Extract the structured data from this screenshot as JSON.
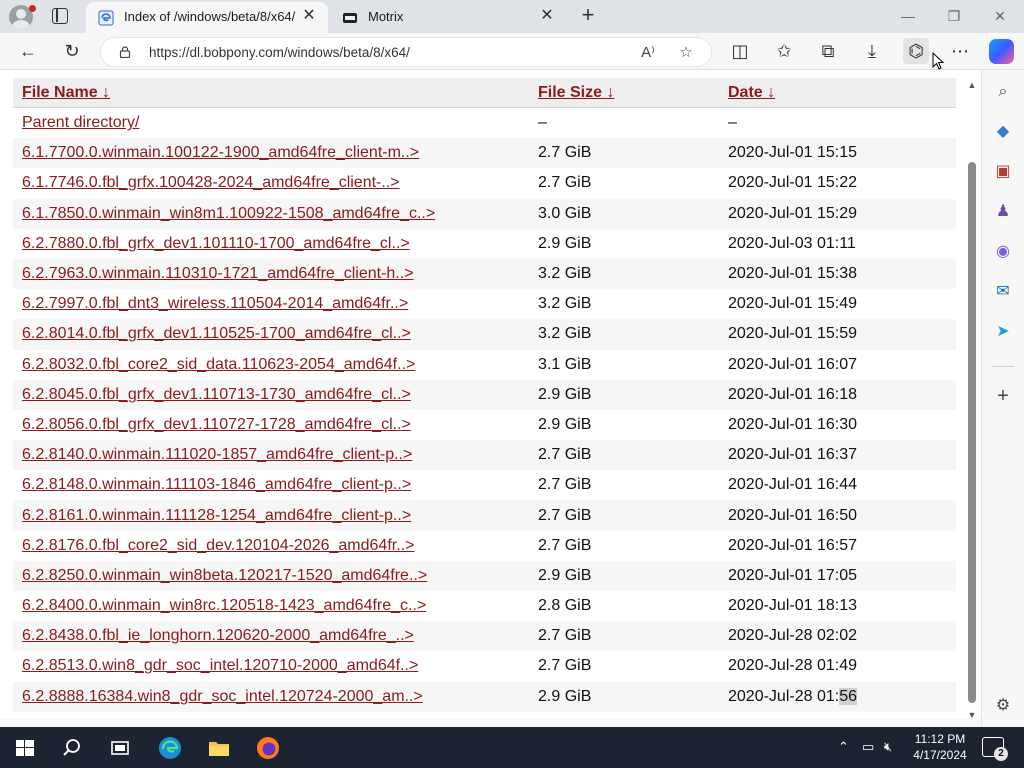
{
  "browser": {
    "tabs": [
      {
        "title": "Index of /windows/beta/8/x64/",
        "active": true
      },
      {
        "title": "Motrix",
        "active": false
      }
    ],
    "url": "https://dl.bobpony.com/windows/beta/8/x64/"
  },
  "listing": {
    "headers": {
      "name": "File Name  ↓",
      "size": "File Size  ↓",
      "date": "Date  ↓"
    },
    "rows": [
      {
        "name": "Parent directory/",
        "size": "–",
        "date": "–"
      },
      {
        "name": "6.1.7700.0.winmain.100122-1900_amd64fre_client-m..>",
        "size": "2.7 GiB",
        "date": "2020-Jul-01 15:15"
      },
      {
        "name": "6.1.7746.0.fbl_grfx.100428-2024_amd64fre_client-..>",
        "size": "2.7 GiB",
        "date": "2020-Jul-01 15:22"
      },
      {
        "name": "6.1.7850.0.winmain_win8m1.100922-1508_amd64fre_c..>",
        "size": "3.0 GiB",
        "date": "2020-Jul-01 15:29"
      },
      {
        "name": "6.2.7880.0.fbl_grfx_dev1.101110-1700_amd64fre_cl..>",
        "size": "2.9 GiB",
        "date": "2020-Jul-03 01:11"
      },
      {
        "name": "6.2.7963.0.winmain.110310-1721_amd64fre_client-h..>",
        "size": "3.2 GiB",
        "date": "2020-Jul-01 15:38"
      },
      {
        "name": "6.2.7997.0.fbl_dnt3_wireless.110504-2014_amd64fr..>",
        "size": "3.2 GiB",
        "date": "2020-Jul-01 15:49"
      },
      {
        "name": "6.2.8014.0.fbl_grfx_dev1.110525-1700_amd64fre_cl..>",
        "size": "3.2 GiB",
        "date": "2020-Jul-01 15:59"
      },
      {
        "name": "6.2.8032.0.fbl_core2_sid_data.110623-2054_amd64f..>",
        "size": "3.1 GiB",
        "date": "2020-Jul-01 16:07"
      },
      {
        "name": "6.2.8045.0.fbl_grfx_dev1.110713-1730_amd64fre_cl..>",
        "size": "2.9 GiB",
        "date": "2020-Jul-01 16:18"
      },
      {
        "name": "6.2.8056.0.fbl_grfx_dev1.110727-1728_amd64fre_cl..>",
        "size": "2.9 GiB",
        "date": "2020-Jul-01 16:30"
      },
      {
        "name": "6.2.8140.0.winmain.111020-1857_amd64fre_client-p..>",
        "size": "2.7 GiB",
        "date": "2020-Jul-01 16:37"
      },
      {
        "name": "6.2.8148.0.winmain.111103-1846_amd64fre_client-p..>",
        "size": "2.7 GiB",
        "date": "2020-Jul-01 16:44"
      },
      {
        "name": "6.2.8161.0.winmain.111128-1254_amd64fre_client-p..>",
        "size": "2.7 GiB",
        "date": "2020-Jul-01 16:50"
      },
      {
        "name": "6.2.8176.0.fbl_core2_sid_dev.120104-2026_amd64fr..>",
        "size": "2.7 GiB",
        "date": "2020-Jul-01 16:57"
      },
      {
        "name": "6.2.8250.0.winmain_win8beta.120217-1520_amd64fre..>",
        "size": "2.9 GiB",
        "date": "2020-Jul-01 17:05"
      },
      {
        "name": "6.2.8400.0.winmain_win8rc.120518-1423_amd64fre_c..>",
        "size": "2.8 GiB",
        "date": "2020-Jul-01 18:13"
      },
      {
        "name": "6.2.8438.0.fbl_ie_longhorn.120620-2000_amd64fre_..>",
        "size": "2.7 GiB",
        "date": "2020-Jul-28 02:02"
      },
      {
        "name": "6.2.8513.0.win8_gdr_soc_intel.120710-2000_amd64f..>",
        "size": "2.7 GiB",
        "date": "2020-Jul-28 01:49"
      },
      {
        "name": "6.2.8888.16384.win8_gdr_soc_intel.120724-2000_am..>",
        "size": "2.9 GiB",
        "date_prefix": "2020-Jul-28 01:",
        "date_selected": "56"
      }
    ]
  },
  "taskbar": {
    "time": "11:12 PM",
    "date": "4/17/2024",
    "notification_count": "2"
  },
  "colors": {
    "link": "#8b1a1a",
    "taskbar_bg": "#1b2430",
    "tabbar_bg": "#dfe3e8"
  },
  "icons": {
    "tab_active_favicon": "edge-page-icon",
    "tab_inactive_favicon": "motrix-icon",
    "toolbar": [
      "back-arrow-icon",
      "refresh-icon",
      "lock-icon",
      "read-aloud-icon",
      "favorite-star-icon",
      "split-screen-icon",
      "favorites-icon",
      "collections-icon",
      "downloads-icon",
      "extension-icon",
      "more-icon",
      "copilot-icon"
    ],
    "sidebar": [
      "search-icon",
      "tag-icon",
      "toolbox-icon",
      "games-icon",
      "office-icon",
      "outlook-icon",
      "send-icon",
      "add-icon",
      "settings-icon"
    ],
    "taskbar": [
      "windows-start-icon",
      "search-icon",
      "task-view-icon",
      "edge-icon",
      "file-explorer-icon",
      "firefox-icon"
    ]
  }
}
